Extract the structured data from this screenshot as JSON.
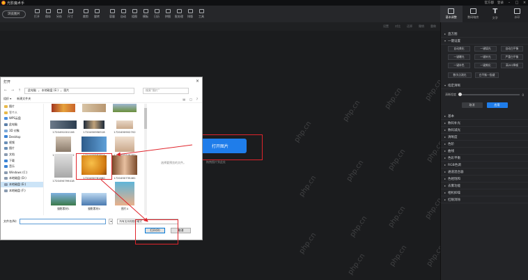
{
  "app": {
    "title": "光影魔术手",
    "top_right": [
      "官方都",
      "登录"
    ]
  },
  "toolbar": {
    "open_button": "浏览图片",
    "tools": [
      "打开",
      "保存",
      "另存",
      "尺寸",
      "裁剪",
      "旋转",
      "容量",
      "自动",
      "组图",
      "模板",
      "日历",
      "拼图",
      "批处理",
      "排版",
      "工具"
    ]
  },
  "rail": {
    "tabs": [
      "基本调整",
      "数码暗房",
      "文字",
      "水印"
    ]
  },
  "subbar": [
    "设置",
    "对比",
    "还原",
    "撤销",
    "重做"
  ],
  "panel": {
    "sections_top": [
      "直方图",
      "一键设置"
    ],
    "grid_buttons": [
      "自动美化",
      "一键填光",
      "自动白平衡",
      "一键曝光",
      "一键补光",
      "严重白平衡",
      "一键补色",
      "一键美化",
      "高ISO降噪"
    ],
    "grid_buttons_row2": [
      "数字点测光",
      "白平衡一指键"
    ],
    "local": "指定清晰",
    "slider_label": "清晰程度",
    "slider_value": "0",
    "cancel": "取消",
    "apply": "应用",
    "rows": [
      "基本",
      "数码补光",
      "数码减光",
      "清晰度",
      "色阶",
      "曲线",
      "色彩平衡",
      "RGB色调",
      "通道混合器",
      "色相饱和",
      "去雾功能",
      "相机抑噪",
      "红眼消除"
    ]
  },
  "canvas": {
    "watermark": "php.cn",
    "open_image": "打开图片",
    "hint_left": "选择要预览的文件。",
    "hint_right": "拖拽图片到此处"
  },
  "dialog": {
    "title": "打开",
    "breadcrumb": [
      "此电脑",
      "本地磁盘 (E:)",
      "图片"
    ],
    "search_placeholder": "搜索\"图片\"",
    "organize": "组织 ▾",
    "new_folder": "新建文件夹",
    "tree": [
      "图片",
      "写个人",
      "WPS云盘",
      "此电脑",
      "3D 对象",
      "Desktop",
      "视频",
      "图片",
      "文档",
      "下载",
      "音乐",
      "Windows (C:)",
      "本地磁盘 (D:)",
      "本地磁盘 (E:)",
      "本地磁盘 (F:)"
    ],
    "files": [
      "",
      "",
      "",
      "1720491001106",
      "1720490958518",
      "1720490902702",
      "1720490882502",
      "1720490883814",
      "1720490846483",
      "1720490799418",
      "1720490781660",
      "1720490735461",
      "摄影素材1",
      "摄影素材4",
      "图片4"
    ],
    "filename_label": "文件名(N):",
    "filetype": "所有支持的图片格式",
    "open": "打开(O)",
    "cancel": "取消"
  },
  "colors": {
    "accent": "#1f7dea",
    "annotation": "#e0242b"
  }
}
